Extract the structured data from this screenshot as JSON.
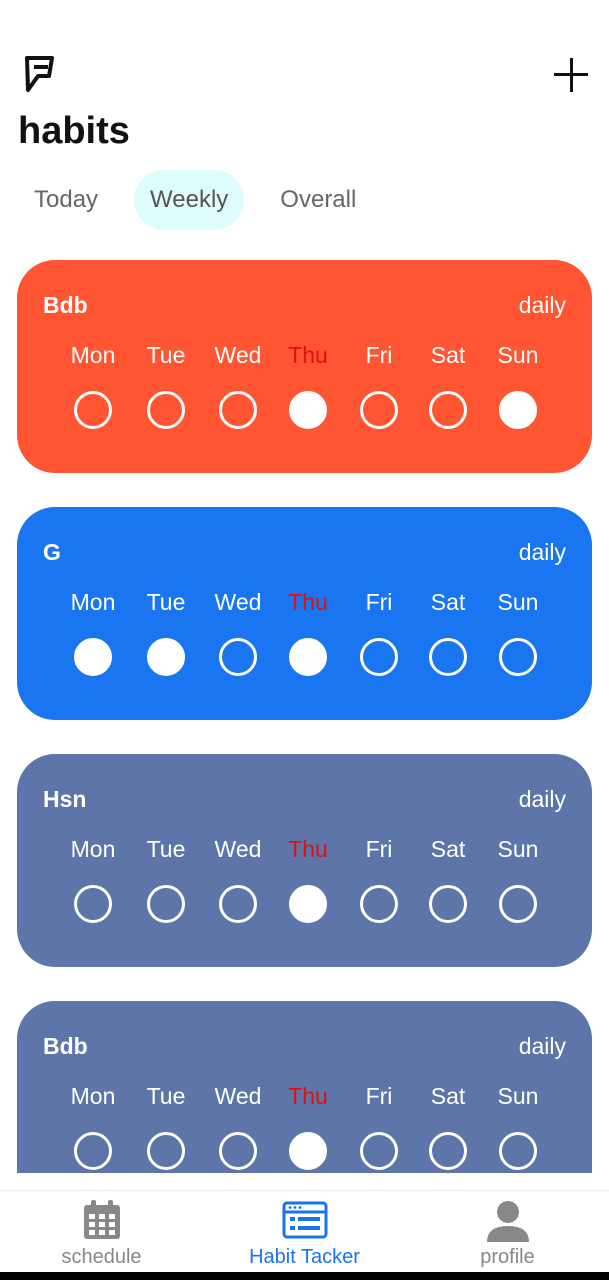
{
  "header": {
    "title": "habits"
  },
  "tabs": [
    {
      "label": "Today",
      "active": false
    },
    {
      "label": "Weekly",
      "active": true
    },
    {
      "label": "Overall",
      "active": false
    }
  ],
  "days": [
    "Mon",
    "Tue",
    "Wed",
    "Thu",
    "Fri",
    "Sat",
    "Sun"
  ],
  "today_index": 3,
  "habits": [
    {
      "name": "Bdb",
      "frequency": "daily",
      "color": "#ff5533",
      "done": [
        false,
        false,
        false,
        true,
        false,
        false,
        true
      ]
    },
    {
      "name": "G",
      "frequency": "daily",
      "color": "#1a75f0",
      "done": [
        true,
        true,
        false,
        true,
        false,
        false,
        false
      ]
    },
    {
      "name": "Hsn",
      "frequency": "daily",
      "color": "#5d75a8",
      "done": [
        false,
        false,
        false,
        true,
        false,
        false,
        false
      ]
    },
    {
      "name": "Bdb",
      "frequency": "daily",
      "color": "#5d75a8",
      "done": [
        false,
        false,
        false,
        true,
        false,
        false,
        false
      ]
    }
  ],
  "nav": [
    {
      "label": "schedule",
      "icon": "calendar-icon",
      "active": false
    },
    {
      "label": "Habit Tacker",
      "icon": "habit-list-icon",
      "active": true
    },
    {
      "label": "profile",
      "icon": "user-icon",
      "active": false
    }
  ],
  "colors": {
    "accent": "#1a73e8",
    "today_day": "#e01010",
    "active_tab_bg": "#dffcfc"
  }
}
